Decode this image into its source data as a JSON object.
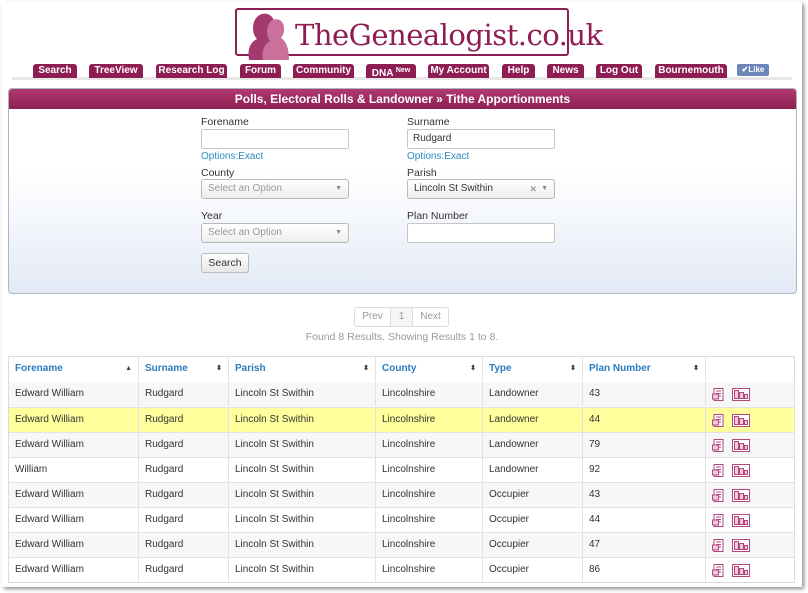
{
  "logo": {
    "text": "TheGenealogist.co.uk"
  },
  "nav": {
    "items": [
      {
        "label": "Search"
      },
      {
        "label": "TreeView"
      },
      {
        "label": "Research Log"
      },
      {
        "label": "Forum"
      },
      {
        "label": "Community"
      },
      {
        "label": "DNA",
        "badge": "New"
      },
      {
        "label": "My Account"
      },
      {
        "label": "Help"
      },
      {
        "label": "News"
      },
      {
        "label": "Log Out"
      },
      {
        "label": "Bournemouth"
      }
    ],
    "like_label": "Like"
  },
  "panel": {
    "title": "Polls, Electoral Rolls & Landowner » Tithe Apportionments",
    "forename_label": "Forename",
    "forename_value": "",
    "forename_options": "Options:Exact",
    "surname_label": "Surname",
    "surname_value": "Rudgard",
    "surname_options": "Options:Exact",
    "county_label": "County",
    "county_placeholder": "Select an Option",
    "parish_label": "Parish",
    "parish_value": "Lincoln St Swithin",
    "year_label": "Year",
    "year_placeholder": "Select an Option",
    "plan_label": "Plan Number",
    "plan_value": "",
    "search_label": "Search"
  },
  "pager": {
    "prev": "Prev",
    "page": "1",
    "next": "Next"
  },
  "results_text": "Found 8 Results. Showing Results 1 to 8.",
  "table": {
    "headers": [
      "Forename",
      "Surname",
      "Parish",
      "County",
      "Type",
      "Plan Number"
    ],
    "rows": [
      [
        "Edward William",
        "Rudgard",
        "Lincoln St Swithin",
        "Lincolnshire",
        "Landowner",
        "43"
      ],
      [
        "Edward William",
        "Rudgard",
        "Lincoln St Swithin",
        "Lincolnshire",
        "Landowner",
        "44"
      ],
      [
        "Edward William",
        "Rudgard",
        "Lincoln St Swithin",
        "Lincolnshire",
        "Landowner",
        "79"
      ],
      [
        "William",
        "Rudgard",
        "Lincoln St Swithin",
        "Lincolnshire",
        "Landowner",
        "92"
      ],
      [
        "Edward William",
        "Rudgard",
        "Lincoln St Swithin",
        "Lincolnshire",
        "Occupier",
        "43"
      ],
      [
        "Edward William",
        "Rudgard",
        "Lincoln St Swithin",
        "Lincolnshire",
        "Occupier",
        "44"
      ],
      [
        "Edward William",
        "Rudgard",
        "Lincoln St Swithin",
        "Lincolnshire",
        "Occupier",
        "47"
      ],
      [
        "Edward William",
        "Rudgard",
        "Lincoln St Swithin",
        "Lincolnshire",
        "Occupier",
        "86"
      ]
    ],
    "highlighted_row": 1
  },
  "colors": {
    "brand": "#8e1d53",
    "link": "#2b7cc0",
    "highlight": "#ffff9d"
  }
}
